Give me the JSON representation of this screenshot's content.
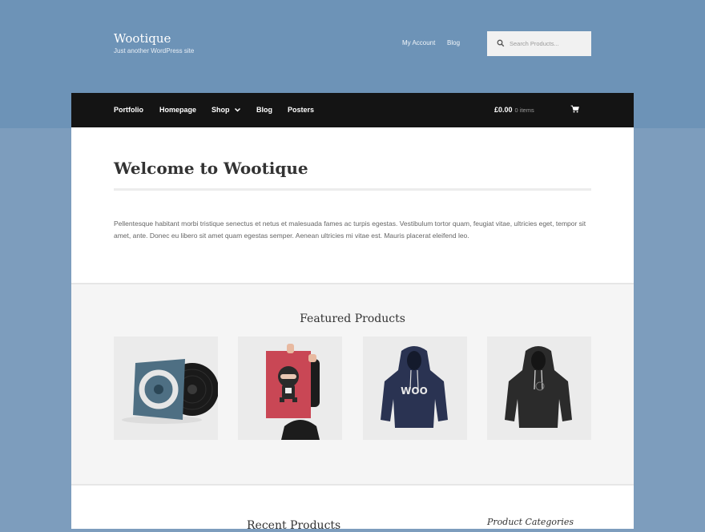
{
  "header": {
    "site_title": "Wootique",
    "tagline": "Just another WordPress site",
    "links": [
      "My Account",
      "Blog"
    ],
    "search_placeholder": "Search Products..."
  },
  "nav": {
    "items": [
      "Portfolio",
      "Homepage",
      "Shop",
      "Blog",
      "Posters"
    ],
    "active": "Homepage",
    "cart_total": "£0.00",
    "cart_count": "0 items"
  },
  "main": {
    "page_title": "Welcome to Wootique",
    "intro": "Pellentesque habitant morbi tristique senectus et netus et malesuada fames ac turpis egestas. Vestibulum tortor quam, feugiat vitae, ultricies eget, tempor sit amet, ante. Donec eu libero sit amet quam egestas semper. Aenean ultricies mi vitae est. Mauris placerat eleifend leo."
  },
  "featured": {
    "title": "Featured Products",
    "products": [
      "vinyl-record",
      "ninja-poster",
      "woo-hoodie-navy",
      "ninja-hoodie-black"
    ]
  },
  "recent": {
    "title": "Recent Products"
  },
  "sidebar": {
    "categories_title": "Product Categories"
  },
  "colors": {
    "background": "#7d9dbd",
    "header_band": "#6d93b7",
    "nav_bg": "#141414",
    "content_bg": "#ffffff"
  }
}
